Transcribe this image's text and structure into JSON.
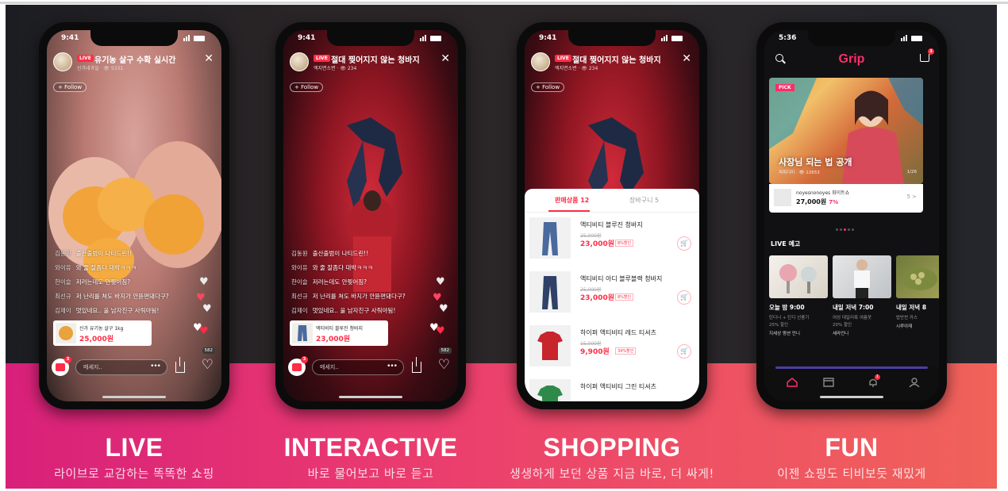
{
  "phones": [
    {
      "status_time": "9:41",
      "live_badge": "LIVE",
      "title": "유기농 살구 수확 실시간",
      "sub": "신가네과일 · 👁 5331",
      "follow": "+ Follow",
      "chat": [
        {
          "user": "김동원",
          "text": "출산출범이 나티드린!!"
        },
        {
          "user": "와이유",
          "text": "와 줄 잘좀다 대박ㅋㅋㅋ"
        },
        {
          "user": "한이슬",
          "text": "저러는데도 안찢어짐?"
        },
        {
          "user": "최선규",
          "text": "저 난리를 쳐도 바지가 안뜯편돼다구?"
        },
        {
          "user": "김제이",
          "text": "멋있네요.. 울 남자친구 사줘야됨!"
        }
      ],
      "product_name": "신가 유기농 살구 1kg",
      "product_price": "25,000원",
      "message_placeholder": "메세지..",
      "like_count": "582"
    },
    {
      "status_time": "9:41",
      "live_badge": "LIVE",
      "title": "절대 찢어지지 않는 청바지",
      "sub": "액지면소변 · 👁 234",
      "follow": "+ Follow",
      "chat": [
        {
          "user": "김동원",
          "text": "출산출범이 나티드린!!"
        },
        {
          "user": "와이유",
          "text": "와 줄 잘좀다 대박ㅋㅋㅋ"
        },
        {
          "user": "한이슬",
          "text": "저러는데도 안찢어짐?"
        },
        {
          "user": "최선규",
          "text": "저 난리를 쳐도 바지가 안뜯편돼다구?"
        },
        {
          "user": "김제이",
          "text": "멋있네요.. 울 남자친구 사줘야됨!"
        }
      ],
      "product_name": "액티비티 블루진 청바지",
      "product_price": "23,000원",
      "message_placeholder": "메세지..",
      "like_count": "582"
    },
    {
      "status_time": "9:41",
      "live_badge": "LIVE",
      "title": "절대 찢어지지 않는 청바지",
      "sub": "액지면소변 · 👁 234",
      "follow": "+ Follow",
      "tabs": {
        "active": "판매상품 12",
        "inactive": "장바구니 5"
      },
      "items": [
        {
          "name": "액티비티 블루진 청바지",
          "old": "25,000원",
          "price": "23,000원",
          "tag": "8%할인"
        },
        {
          "name": "액티비티 아디 블루블랙 청바지",
          "old": "25,000원",
          "price": "23,000원",
          "tag": "8%할인"
        },
        {
          "name": "하이퍼 액티비티 레드 티셔츠",
          "old": "15,000원",
          "price": "9,900원",
          "tag": "34%할인"
        },
        {
          "name": "하이퍼 액티비티 그린 티셔츠",
          "old": "",
          "price": "",
          "tag": ""
        }
      ]
    },
    {
      "status_time": "5:36",
      "logo": "Grip",
      "cart_badge": "3",
      "hero": {
        "badge": "PICK",
        "title": "사장님 되는 법 공개",
        "sub": "피피디미 · 👁 12653",
        "counter": "1/26"
      },
      "hero_product": {
        "name": "noyesnonoyes 화이트쇼",
        "price": "27,000원",
        "discount": "7%",
        "count": "5 >"
      },
      "section": "LIVE 예고",
      "live_cards": [
        {
          "time": "오늘 밤 9:00",
          "d1": "탄디너 + 탄디 선풍기",
          "d2": "25% 할인",
          "d3": "지세상 쩡션 언니"
        },
        {
          "time": "내일 저녁 7:00",
          "d1": "여성 데일리룩 여름옷",
          "d2": "20% 할인",
          "d3": "세라언니"
        },
        {
          "time": "내일 저녁 8",
          "d1": "밥반찬 카스",
          "d2": "",
          "d3": "시루아재"
        }
      ],
      "nav_badge": "1"
    }
  ],
  "captions": [
    {
      "title": "LIVE",
      "sub": "라이브로 교감하는 똑똑한 쇼핑"
    },
    {
      "title": "INTERACTIVE",
      "sub": "바로 물어보고 바로 듣고"
    },
    {
      "title": "SHOPPING",
      "sub": "생생하게 보던 상품 지금 바로, 더 싸게!"
    },
    {
      "title": "FUN",
      "sub": "이젠 쇼핑도 티비보듯 재밌게"
    }
  ]
}
